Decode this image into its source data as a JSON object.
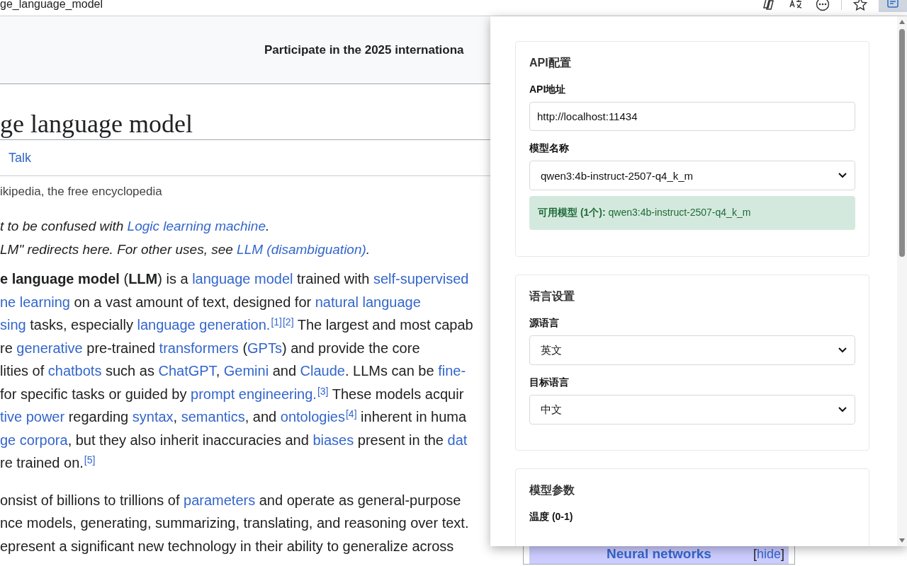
{
  "browser": {
    "address": "ge_language_model",
    "toolbar": [
      {
        "kind": "copilot",
        "selected": false
      },
      {
        "kind": "translate",
        "selected": false
      },
      {
        "kind": "more",
        "selected": false
      },
      {
        "kind": "star",
        "selected": false
      },
      {
        "kind": "extension",
        "selected": true
      }
    ]
  },
  "banner": {
    "text": "Participate in the 2025 internationa"
  },
  "article": {
    "title": "ge language model",
    "tabs": [
      {
        "label": "Talk",
        "selected": false
      }
    ],
    "tagline": "ikipedia, the free encyclopedia",
    "hatnotes": [
      [
        {
          "t": "t to be confused with ",
          "kind": "text"
        },
        {
          "t": "Logic learning machine",
          "kind": "link"
        },
        {
          "t": ".",
          "kind": "text"
        }
      ],
      [
        {
          "t": "LM\" redirects here. For other uses, see ",
          "kind": "text"
        },
        {
          "t": "LLM (disambiguation)",
          "kind": "link"
        },
        {
          "t": ".",
          "kind": "text"
        }
      ]
    ],
    "paragraphs": [
      {
        "lines": [
          [
            {
              "t": "e language model",
              "kind": "bold"
            },
            {
              "t": " (",
              "kind": "text"
            },
            {
              "t": "LLM",
              "kind": "bold"
            },
            {
              "t": ") is a ",
              "kind": "text"
            },
            {
              "t": "language model",
              "kind": "link"
            },
            {
              "t": " trained with ",
              "kind": "text"
            },
            {
              "t": "self-supervised",
              "kind": "link"
            }
          ],
          [
            {
              "t": "ne learning",
              "kind": "link"
            },
            {
              "t": " on a vast amount of text, designed for ",
              "kind": "text"
            },
            {
              "t": "natural language",
              "kind": "link"
            }
          ],
          [
            {
              "t": "sing",
              "kind": "link"
            },
            {
              "t": " tasks, especially ",
              "kind": "text"
            },
            {
              "t": "language generation.",
              "kind": "link"
            },
            {
              "t": "[1]",
              "kind": "ref"
            },
            {
              "t": "[2]",
              "kind": "ref"
            },
            {
              "t": " The largest and most capab",
              "kind": "text"
            }
          ],
          [
            {
              "t": "re ",
              "kind": "text"
            },
            {
              "t": "generative",
              "kind": "link"
            },
            {
              "t": " pre-trained ",
              "kind": "text"
            },
            {
              "t": "transformers",
              "kind": "link"
            },
            {
              "t": " (",
              "kind": "text"
            },
            {
              "t": "GPTs",
              "kind": "link"
            },
            {
              "t": ") and provide the core",
              "kind": "text"
            }
          ],
          [
            {
              "t": "lities of ",
              "kind": "text"
            },
            {
              "t": "chatbots",
              "kind": "link"
            },
            {
              "t": " such as ",
              "kind": "text"
            },
            {
              "t": "ChatGPT",
              "kind": "link"
            },
            {
              "t": ", ",
              "kind": "text"
            },
            {
              "t": "Gemini",
              "kind": "link"
            },
            {
              "t": " and ",
              "kind": "text"
            },
            {
              "t": "Claude",
              "kind": "link"
            },
            {
              "t": ". LLMs can be ",
              "kind": "text"
            },
            {
              "t": "fine-",
              "kind": "link"
            }
          ],
          [
            {
              "t": "for specific tasks or guided by ",
              "kind": "text"
            },
            {
              "t": "prompt engineering.",
              "kind": "link"
            },
            {
              "t": "[3]",
              "kind": "ref"
            },
            {
              "t": " These models acquir",
              "kind": "text"
            }
          ],
          [
            {
              "t": "tive power",
              "kind": "link"
            },
            {
              "t": " regarding ",
              "kind": "text"
            },
            {
              "t": "syntax",
              "kind": "link"
            },
            {
              "t": ", ",
              "kind": "text"
            },
            {
              "t": "semantics",
              "kind": "link"
            },
            {
              "t": ", and ",
              "kind": "text"
            },
            {
              "t": "ontologies",
              "kind": "link"
            },
            {
              "t": "[4]",
              "kind": "ref"
            },
            {
              "t": " inherent in huma",
              "kind": "text"
            }
          ],
          [
            {
              "t": "ge corpora",
              "kind": "link"
            },
            {
              "t": ", but they also inherit inaccuracies and ",
              "kind": "text"
            },
            {
              "t": "biases",
              "kind": "link"
            },
            {
              "t": " present in the ",
              "kind": "text"
            },
            {
              "t": "dat",
              "kind": "link"
            }
          ],
          [
            {
              "t": "re trained on.",
              "kind": "text"
            },
            {
              "t": "[5]",
              "kind": "ref"
            }
          ]
        ]
      },
      {
        "lines": [
          [
            {
              "t": "onsist of billions to trillions of ",
              "kind": "text"
            },
            {
              "t": "parameters",
              "kind": "link"
            },
            {
              "t": " and operate as general-purpose",
              "kind": "text"
            }
          ],
          [
            {
              "t": "nce models, generating, summarizing, translating, and reasoning over text.",
              "kind": "text"
            }
          ],
          [
            {
              "t": "epresent a significant new technology in their ability to generalize across",
              "kind": "text"
            }
          ]
        ]
      }
    ]
  },
  "navbox": {
    "title": "Neural networks",
    "toggle": [
      {
        "t": "[",
        "kind": "text"
      },
      {
        "t": "hide",
        "kind": "link"
      },
      {
        "t": "]",
        "kind": "text"
      }
    ]
  },
  "panel": {
    "sections": [
      {
        "title": "API配置",
        "fields": [
          {
            "kind": "text",
            "label": "API地址",
            "value": "http://localhost:11434"
          },
          {
            "kind": "select",
            "label": "模型名称",
            "value": "qwen3:4b-instruct-2507-q4_k_m"
          },
          {
            "kind": "notice",
            "label": "可用模型 (1个):",
            "value": "qwen3:4b-instruct-2507-q4_k_m"
          }
        ]
      },
      {
        "title": "语言设置",
        "fields": [
          {
            "kind": "select",
            "label": "源语言",
            "value": "英文"
          },
          {
            "kind": "select",
            "label": "目标语言",
            "value": "中文"
          }
        ]
      },
      {
        "title": "模型参数",
        "fields": [
          {
            "kind": "label",
            "label": "温度 (0-1)"
          }
        ]
      }
    ]
  }
}
